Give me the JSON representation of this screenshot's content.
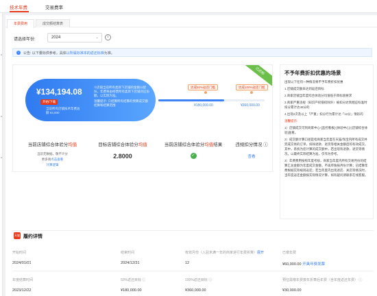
{
  "top_tabs": [
    {
      "label": "技术年费",
      "active": true
    },
    {
      "label": "交易费率",
      "active": false
    }
  ],
  "sub_tabs": [
    {
      "label": "年费费用",
      "active": true
    },
    {
      "label": "成交额结算表",
      "active": false
    }
  ],
  "year_filter": {
    "label": "请选择年份:",
    "value": "2024"
  },
  "notice": {
    "text": "公告: 以下量标供参考，具体",
    "link": "以所属标准本的返还标准",
    "suffix": "为准。"
  },
  "summary": {
    "amount": "¥134,194.08",
    "tag": "开始/下载",
    "note_line1": "当前所有店铺技术年费总",
    "note_line2": "额 ¥3,000",
    "right_line1": "①店铺当前所有类目下店铺的金额分配份，年费将由经营所有类目下店铺对应份额，以实际为准。",
    "right_line2": "温馨提示: 只结算所有结算的预算成交额结算和结算范围",
    "corner_badge": "已达标",
    "progress_pct": 0.62,
    "markers": [
      {
        "label": "达成50%返还门槛",
        "price": "¥180,000.00"
      },
      {
        "label": "达成100%返还门槛",
        "price": "¥360,000.00"
      }
    ]
  },
  "metrics": [
    {
      "head_pre": "当前店铺综合体验分",
      "head_red": "均值",
      "value": "",
      "sub1": "当前无数据，敬不计分",
      "sub2_pre": "更多请",
      "sub2_link": "点击查看",
      "sub3_link": "计算逻辑"
    },
    {
      "head_pre": "目标店铺综合体验分",
      "head_red": "均值",
      "value": "2.8000"
    },
    {
      "head_pre": "当前店铺综合体验分",
      "head_red": "均值",
      "head_post": "结果",
      "check": "✓"
    },
    {
      "head_pre": "违规扣分情况",
      "info": "ⓘ",
      "link": "查看"
    }
  ],
  "rules": {
    "title": "不予年费折扣优惠的场景",
    "intro": "出现以下任何一种情况将不予年费折扣优惠",
    "items": [
      "1.店铺成交额未达到返还目标",
      "2.商家店铺当年度综合体验分均值低于目标值要求",
      "3.商家严重违规（知识产权侵权除外）被扣分达到相应标准时扣分累计达48分的",
      "4.出现2次及以上「严重」扣分行为累计达「12分」情形的"
    ],
    "hint_title": "温馨提示:",
    "hints": [
      "1）店铺成交可到商家中心-[监控看板]-[体验中心]-[店铺综合体验]查看。",
      "2）成交额计算口径是指商家当年度在天猫/淘宝内所有成交并完成交易的订单，扣除退款、退货等相关金额后的有效成交。其中，系统为您计算的成交额中，若出现有退款、退货等情况，以最终实际结算为准，仅作为参考。",
      "3）年费费用按照年度考核，商家当年度内所有交易月份的结算汇总金额为年度成交金额，不再单独按月份计算；已结算年费根据实际规则返还；若当年度内出现退店、关店等情况时，当年度返还金额按实际情况计算，如有疑问请联系在线客服。"
    ]
  },
  "contract": {
    "title": "履约详情",
    "rows": [
      [
        {
          "label": "开始时间",
          "value": "2024/01/01"
        },
        {
          "label": "结束时间",
          "value": "2024/12/31"
        },
        {
          "label": "有效月份（入驻未满一年的商家进行年费折算）",
          "label_link": "展开",
          "value": "12"
        },
        {
          "label": "已缴年费",
          "value": "¥60,000.00",
          "value_link": "开具年费发票"
        }
      ],
      [
        {
          "label": "年度结算时间",
          "value": "2023/12/22"
        },
        {
          "label": "50%返还目标",
          "info": "ⓘ",
          "value": "¥180,000.00"
        },
        {
          "label": "100%返还目标",
          "info": "ⓘ",
          "value": "¥360,000.00"
        },
        {
          "label": "预估需缴年费按年折算后年费（含年度返还年费）",
          "info": "ⓘ",
          "value": "¥30,000.00"
        }
      ]
    ]
  },
  "colors": {
    "accent": "#e8391a",
    "link": "#3b82f6",
    "badge": "#6cc04a",
    "card_from": "#2f7af0",
    "card_to": "#5aa6ff"
  }
}
